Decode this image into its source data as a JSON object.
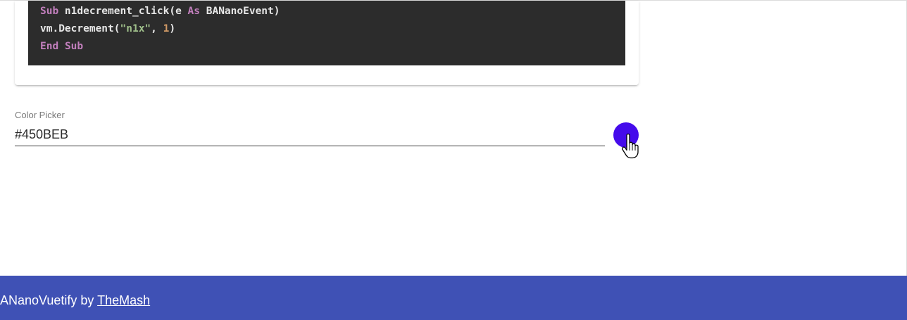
{
  "code": {
    "line1": {
      "kw1": "Sub",
      "rest1": " n1decrement_click(e ",
      "kw2": "As",
      "rest2": " BANanoEvent)"
    },
    "line2": {
      "pre": "vm.Decrement(",
      "str": "\"n1x\"",
      "mid": ", ",
      "num": "1",
      "post": ")"
    },
    "line3": {
      "kw1": "End",
      "sp": " ",
      "kw2": "Sub"
    }
  },
  "color_picker": {
    "label": "Color Picker",
    "value": "#450BEB",
    "swatch_color": "#450beb"
  },
  "footer": {
    "text": "ANanoVuetify by ",
    "link": "TheMash",
    "background": "#3f51b5"
  }
}
